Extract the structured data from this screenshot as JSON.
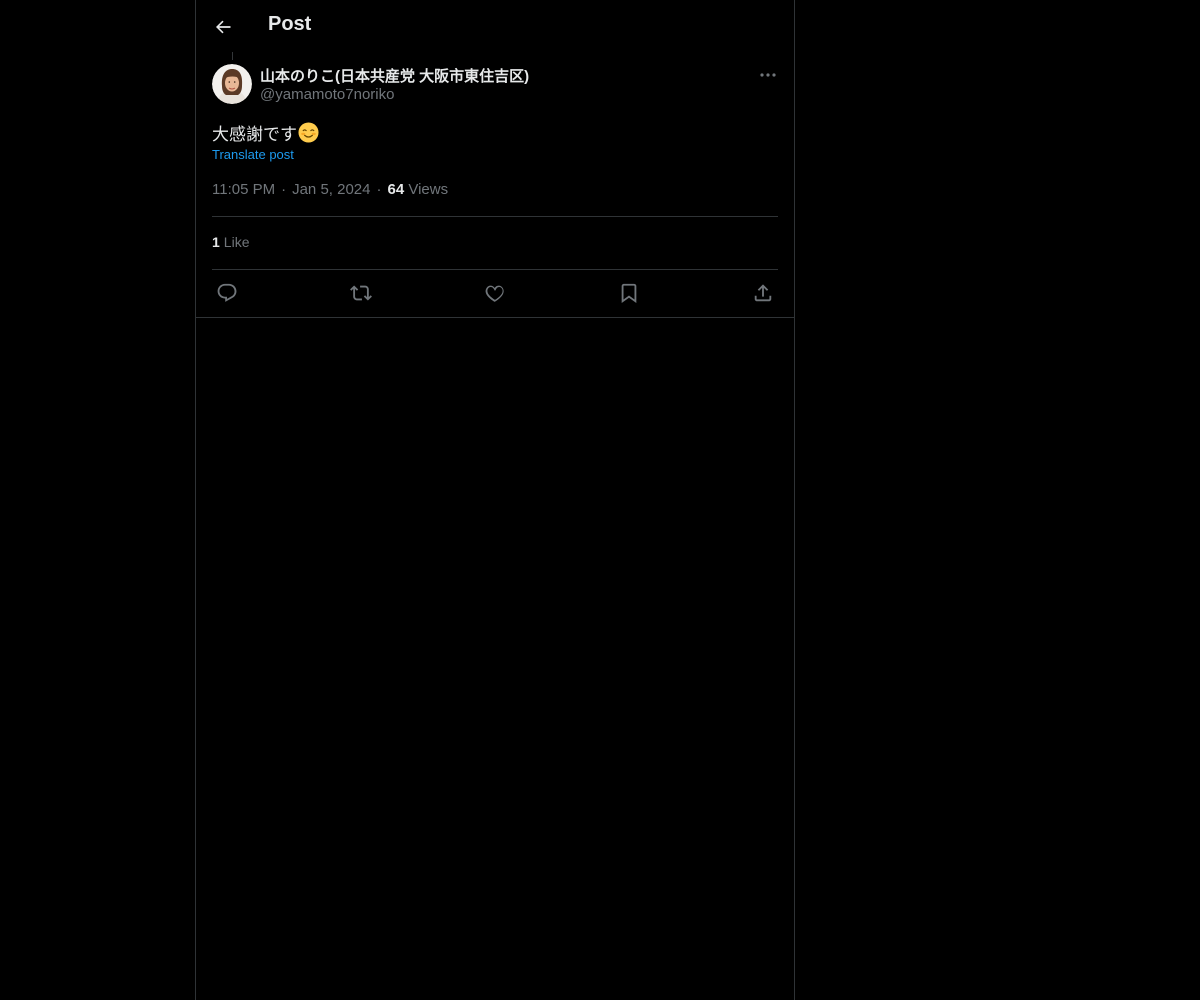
{
  "header": {
    "title": "Post",
    "back_icon": "arrow-left-icon"
  },
  "post": {
    "author": {
      "name": "山本のりこ(日本共産党 大阪市東住吉区)",
      "handle": "@yamamoto7noriko",
      "avatar": "profile-photo"
    },
    "text": "大感謝です",
    "emoji": "relieved-smiling-face-emoji",
    "translate_label": "Translate post",
    "time": "11:05 PM",
    "date": "Jan 5, 2024",
    "separator": "·",
    "views_count": "64",
    "views_label": "Views",
    "likes_count": "1",
    "likes_label": "Like",
    "actions": [
      "reply-icon",
      "repost-icon",
      "like-icon",
      "bookmark-icon",
      "share-icon"
    ]
  },
  "colors": {
    "background": "#000000",
    "text_primary": "#e7e9ea",
    "text_secondary": "#71767b",
    "accent": "#1d9bf0",
    "border": "#2f3336"
  }
}
